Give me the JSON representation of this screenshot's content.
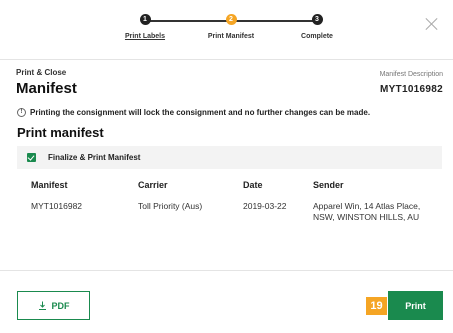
{
  "stepper": {
    "steps": [
      {
        "number": "1",
        "label": "Print Labels",
        "state": "done"
      },
      {
        "number": "2",
        "label": "Print Manifest",
        "state": "active"
      },
      {
        "number": "3",
        "label": "Complete",
        "state": "todo"
      }
    ]
  },
  "header": {
    "subtitle": "Print & Close",
    "title": "Manifest",
    "description_label": "Manifest Description",
    "description_value": "MYT1016982"
  },
  "warning": {
    "icon": "!",
    "text": "Printing the consignment will lock the consignment and no further changes can be made."
  },
  "section": {
    "title": "Print manifest",
    "finalize_label": "Finalize & Print Manifest",
    "finalize_checked": true
  },
  "table": {
    "columns": [
      "Manifest",
      "Carrier",
      "Date",
      "Sender"
    ],
    "rows": [
      [
        "MYT1016982",
        "Toll Priority (Aus)",
        "2019-03-22",
        "Apparel Win, 14 Atlas Place, NSW, WINSTON HILLS, AU"
      ]
    ]
  },
  "footer": {
    "pdf_label": "PDF",
    "badge": "19",
    "print_label": "Print"
  },
  "colors": {
    "accent_green": "#1a8a4e",
    "active_step_orange": "#f5a524"
  }
}
